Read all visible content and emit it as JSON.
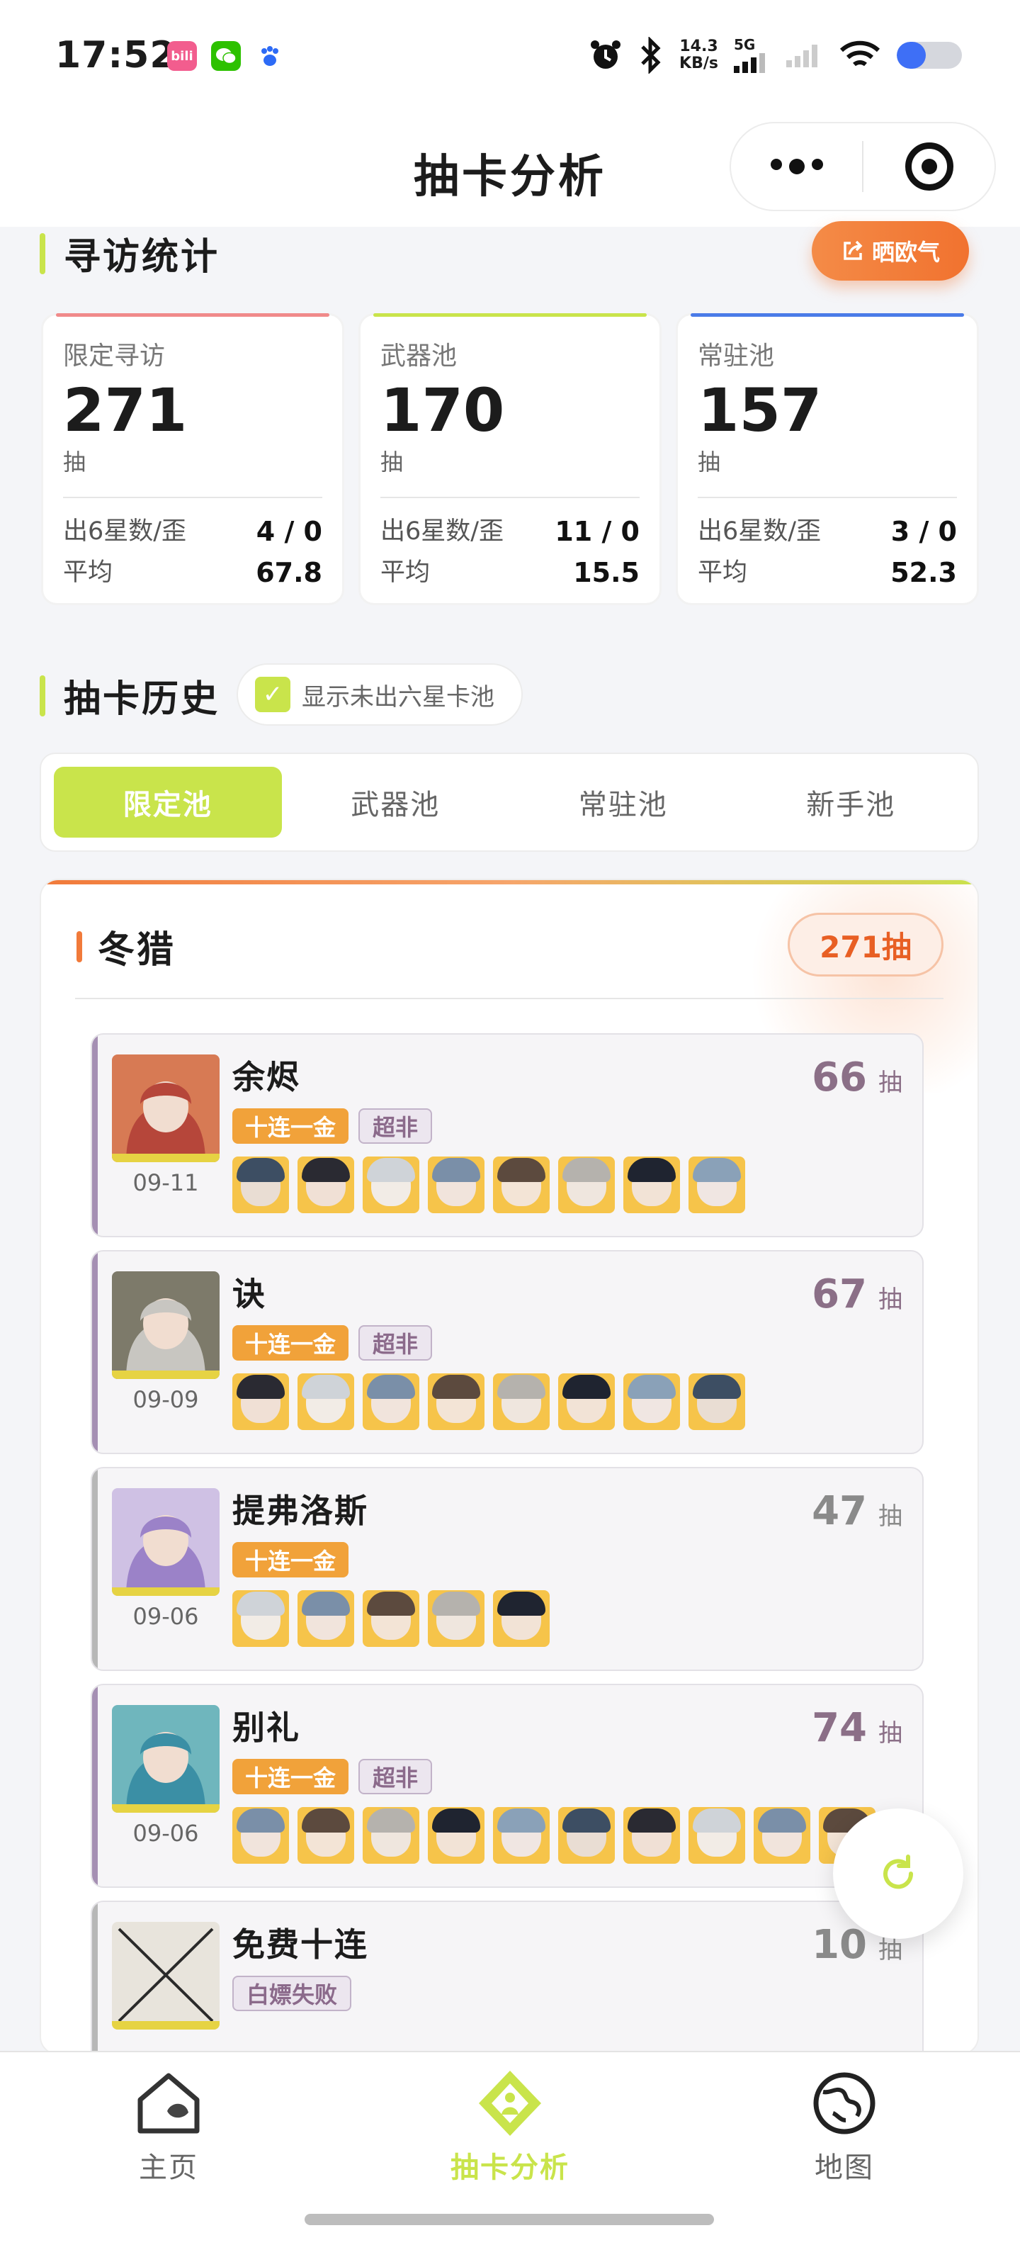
{
  "status": {
    "time": "17:52",
    "net_speed": "14.3",
    "net_unit": "KB/s",
    "net_type": "5G",
    "battery_level": 0.45,
    "apps": [
      {
        "name": "bilibili-icon",
        "color": "#f25d8e",
        "label": "bili"
      },
      {
        "name": "wechat-icon",
        "color": "#2dc100",
        "label": "✆"
      },
      {
        "name": "baidu-icon",
        "color": "#ffffff",
        "label": "du"
      }
    ]
  },
  "nav": {
    "title": "抽卡分析"
  },
  "summary": {
    "title": "寻访统计",
    "share_label": "晒欧气",
    "cards": [
      {
        "label": "限定寻访",
        "count": "271",
        "unit": "抽",
        "row1_label": "出6星数/歪",
        "row1_value": "4 / 0",
        "row2_label": "平均",
        "row2_value": "67.8",
        "accent": "#f08a8a"
      },
      {
        "label": "武器池",
        "count": "170",
        "unit": "抽",
        "row1_label": "出6星数/歪",
        "row1_value": "11 / 0",
        "row2_label": "平均",
        "row2_value": "15.5",
        "accent": "#c9e44b"
      },
      {
        "label": "常驻池",
        "count": "157",
        "unit": "抽",
        "row1_label": "出6星数/歪",
        "row1_value": "3 / 0",
        "row2_label": "平均",
        "row2_value": "52.3",
        "accent": "#4a7be8"
      }
    ]
  },
  "history": {
    "title": "抽卡历史",
    "toggle_label": "显示未出六星卡池",
    "toggle_checked": true,
    "tabs": [
      "限定池",
      "武器池",
      "常驻池",
      "新手池"
    ],
    "active_tab": 0
  },
  "pool": {
    "name": "冬猎",
    "total": "271抽",
    "entries": [
      {
        "name": "余烬",
        "count": "66",
        "unit": "抽",
        "date": "09-11",
        "badges": [
          {
            "text": "十连一金",
            "kind": "gold"
          },
          {
            "text": "超非",
            "kind": "purple"
          }
        ],
        "style": "purple",
        "portrait_colors": [
          "#b6463a",
          "#d77a54"
        ],
        "mini": 8
      },
      {
        "name": "诀",
        "count": "67",
        "unit": "抽",
        "date": "09-09",
        "badges": [
          {
            "text": "十连一金",
            "kind": "gold"
          },
          {
            "text": "超非",
            "kind": "purple"
          }
        ],
        "style": "purple",
        "portrait_colors": [
          "#c8c6c1",
          "#7d7a6a"
        ],
        "mini": 8
      },
      {
        "name": "提弗洛斯",
        "count": "47",
        "unit": "抽",
        "date": "09-06",
        "badges": [
          {
            "text": "十连一金",
            "kind": "gold"
          }
        ],
        "style": "gray",
        "portrait_colors": [
          "#9b82c8",
          "#cfc1e4"
        ],
        "mini": 5
      },
      {
        "name": "别礼",
        "count": "74",
        "unit": "抽",
        "date": "09-06",
        "badges": [
          {
            "text": "十连一金",
            "kind": "gold"
          },
          {
            "text": "超非",
            "kind": "purple"
          }
        ],
        "style": "purple",
        "portrait_colors": [
          "#3b8fa5",
          "#6fb6bd"
        ],
        "mini": 10
      },
      {
        "name": "免费十连",
        "count": "10",
        "unit": "抽",
        "date": "",
        "badges": [
          {
            "text": "白嫖失败",
            "kind": "purple"
          }
        ],
        "style": "gray",
        "portrait_colors": [
          "#e8e4dc",
          "#c9c3b6"
        ],
        "mini": 0
      }
    ]
  },
  "tabbar": [
    {
      "label": "主页",
      "icon": "home-icon",
      "active": false
    },
    {
      "label": "抽卡分析",
      "icon": "gacha-analysis-icon",
      "active": true
    },
    {
      "label": "地图",
      "icon": "globe-map-icon",
      "active": false
    }
  ]
}
